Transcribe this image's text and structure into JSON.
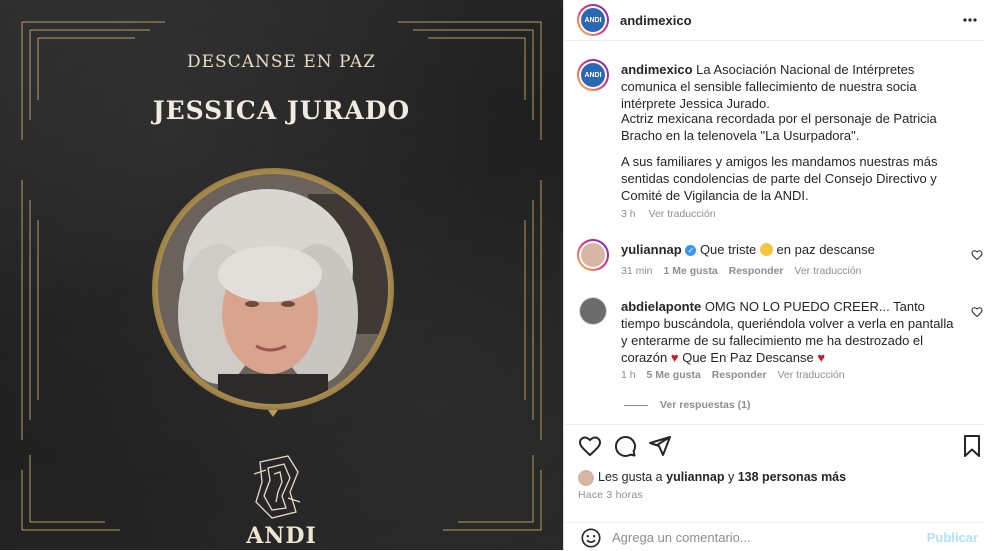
{
  "post_image": {
    "title": "DESCANSE EN PAZ",
    "name": "JESSICA JURADO",
    "logo_text": "ANDI",
    "accent_gold": "#c8aa6e"
  },
  "header": {
    "username": "andimexico",
    "more_icon": "more-horizontal-icon"
  },
  "caption": {
    "username": "andimexico",
    "paragraph1": "La Asociación Nacional de Intérpretes comunica el sensible fallecimiento de nuestra socia intérprete Jessica Jurado.",
    "paragraph2": "Actriz mexicana recordada por el personaje de Patricia Bracho en la telenovela \"La Usurpadora\".",
    "paragraph3": "A sus familiares y amigos les mandamos nuestras más sentidas condolencias de parte del Consejo Directivo y Comité de Vigilancia de la ANDI.",
    "time": "3 h",
    "see_translation": "Ver traducción"
  },
  "comments": [
    {
      "username": "yuliannap",
      "text_before": "Que triste",
      "text_after": "en paz descanse",
      "time": "31 min",
      "likes": "1 Me gusta",
      "reply": "Responder",
      "translation": "Ver traducción"
    },
    {
      "username": "abdielaponte",
      "text": "OMG NO LO PUEDO CREER... Tanto tiempo buscándola, queriéndola volver a verla en pantalla y enterarme de su fallecimiento me ha destrozado el corazón",
      "text_tail": "Que En Paz Descanse",
      "time": "1 h",
      "likes": "5 Me gusta",
      "reply": "Responder",
      "translation": "Ver traducción",
      "view_replies": "Ver respuestas (1)"
    }
  ],
  "likes": {
    "prefix": "Les gusta a",
    "user": "yuliannap",
    "connector": "y",
    "others": "138 personas más"
  },
  "posted_ago": "Hace 3 horas",
  "comment_box": {
    "placeholder": "Agrega un comentario...",
    "publish": "Publicar"
  }
}
